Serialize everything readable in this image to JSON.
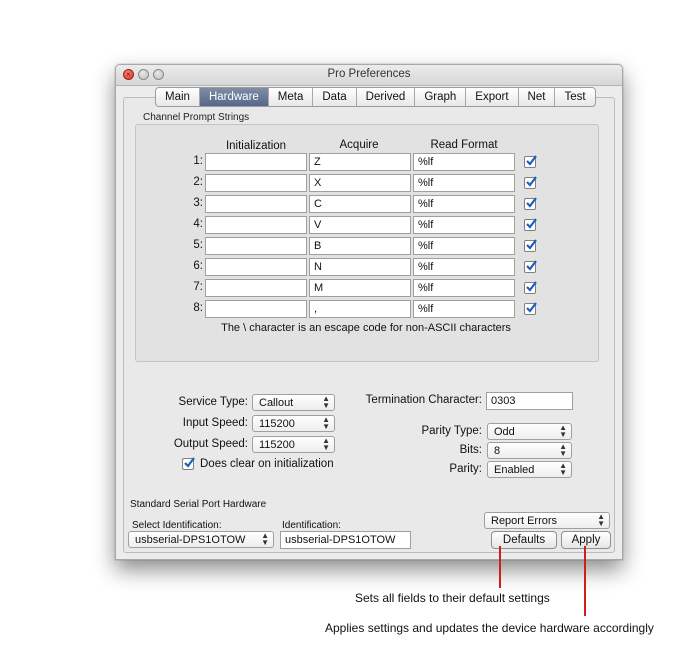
{
  "window": {
    "title": "Pro Preferences"
  },
  "tabs": [
    "Main",
    "Hardware",
    "Meta",
    "Data",
    "Derived",
    "Graph",
    "Export",
    "Net",
    "Test"
  ],
  "active_tab": "Hardware",
  "channel_prompts": {
    "section_label": "Channel Prompt Strings",
    "headers": {
      "init": "Initialization",
      "acquire": "Acquire",
      "read": "Read Format"
    },
    "rows": [
      {
        "num": "1:",
        "init": "",
        "acquire": "Z",
        "read": "%lf",
        "checked": true
      },
      {
        "num": "2:",
        "init": "",
        "acquire": "X",
        "read": "%lf",
        "checked": true
      },
      {
        "num": "3:",
        "init": "",
        "acquire": "C",
        "read": "%lf",
        "checked": true
      },
      {
        "num": "4:",
        "init": "",
        "acquire": "V",
        "read": "%lf",
        "checked": true
      },
      {
        "num": "5:",
        "init": "",
        "acquire": "B",
        "read": "%lf",
        "checked": true
      },
      {
        "num": "6:",
        "init": "",
        "acquire": "N",
        "read": "%lf",
        "checked": true
      },
      {
        "num": "7:",
        "init": "",
        "acquire": "M",
        "read": "%lf",
        "checked": true
      },
      {
        "num": "8:",
        "init": "",
        "acquire": ",",
        "read": "%lf",
        "checked": true
      }
    ],
    "note": "The \\ character is an escape code for non-ASCII characters"
  },
  "serial": {
    "service_type": {
      "label": "Service Type:",
      "value": "Callout"
    },
    "input_speed": {
      "label": "Input Speed:",
      "value": "115200"
    },
    "output_speed": {
      "label": "Output Speed:",
      "value": "115200"
    },
    "clear_on_init": {
      "label": "Does clear on initialization",
      "checked": true
    },
    "termination": {
      "label": "Termination Character:",
      "value": "0303"
    },
    "parity_type": {
      "label": "Parity Type:",
      "value": "Odd"
    },
    "bits": {
      "label": "Bits:",
      "value": "8"
    },
    "parity": {
      "label": "Parity:",
      "value": "Enabled"
    }
  },
  "hardware": {
    "section_label": "Standard Serial Port Hardware",
    "select_id_label": "Select Identification:",
    "select_id_value": "usbserial-DPS1OTOW",
    "id_label": "Identification:",
    "id_value": "usbserial-DPS1OTOW"
  },
  "report_errors": "Report Errors",
  "buttons": {
    "defaults": "Defaults",
    "apply": "Apply"
  },
  "callouts": {
    "defaults": "Sets all fields to their default settings",
    "apply": "Applies settings and updates the device hardware accordingly"
  },
  "colors": {
    "accent_tab": "#5f7090",
    "callout_line": "#d01e1e",
    "check": "#1a5fbf"
  }
}
